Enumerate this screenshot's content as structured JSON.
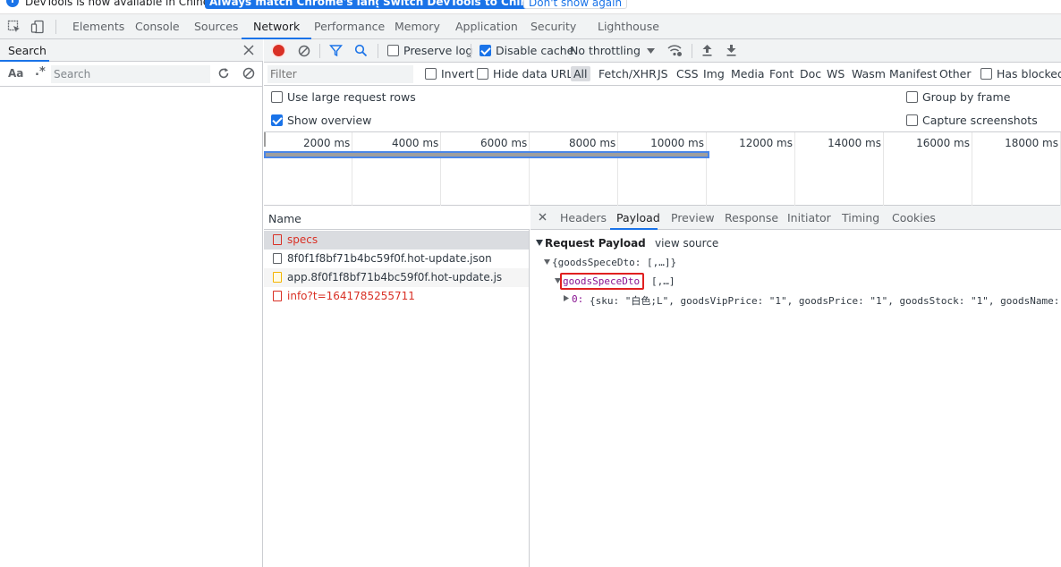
{
  "infobar": {
    "message": "DevTools is now available in Chinese!",
    "btn_match": "Always match Chrome's language",
    "btn_switch": "Switch DevTools to Chinese",
    "btn_dont_show": "Don't show again"
  },
  "tabs": [
    "Elements",
    "Console",
    "Sources",
    "Network",
    "Performance",
    "Memory",
    "Application",
    "Security",
    "Lighthouse"
  ],
  "sidebar": {
    "tab_label": "Search",
    "aa_label": "Aa",
    "regex_label": ".*",
    "search_placeholder": "Search"
  },
  "toolbar": {
    "preserve_log": "Preserve log",
    "disable_cache": "Disable cache",
    "throttling": "No throttling"
  },
  "filter": {
    "placeholder": "Filter",
    "invert": "Invert",
    "hide_data_urls": "Hide data URLs",
    "types": [
      "All",
      "Fetch/XHR",
      "JS",
      "CSS",
      "Img",
      "Media",
      "Font",
      "Doc",
      "WS",
      "Wasm",
      "Manifest",
      "Other"
    ],
    "has_blocked": "Has blocked cookies"
  },
  "options": {
    "large_rows": "Use large request rows",
    "show_overview": "Show overview",
    "group_by_frame": "Group by frame",
    "capture_screenshots": "Capture screenshots"
  },
  "overview": {
    "ticks": [
      "2000 ms",
      "4000 ms",
      "6000 ms",
      "8000 ms",
      "10000 ms",
      "12000 ms",
      "14000 ms",
      "16000 ms",
      "18000 ms"
    ]
  },
  "requests": {
    "column_name": "Name",
    "rows": [
      {
        "name": "specs",
        "status": "error"
      },
      {
        "name": "8f0f1f8bf71b4bc59f0f.hot-update.json",
        "status": "ok"
      },
      {
        "name": "app.8f0f1f8bf71b4bc59f0f.hot-update.js",
        "status": "ok"
      },
      {
        "name": "info?t=1641785255711",
        "status": "error"
      }
    ]
  },
  "details": {
    "tabs": [
      "Headers",
      "Payload",
      "Preview",
      "Response",
      "Initiator",
      "Timing",
      "Cookies"
    ],
    "payload_title": "Request Payload",
    "view_source": "view source",
    "root_line": "{goodsSpeceDto: [,…]}",
    "key_name": "goodsSpeceDto",
    "key_value": "[,…]",
    "item_index": "0:",
    "item_value": "{sku: \"白色;L\", goodsVipPrice: \"1\", goodsPrice: \"1\", goodsStock: \"1\", goodsName: "
  },
  "colors": {
    "accent": "#1a73e8",
    "error": "#d93025",
    "record": "#d93025"
  }
}
